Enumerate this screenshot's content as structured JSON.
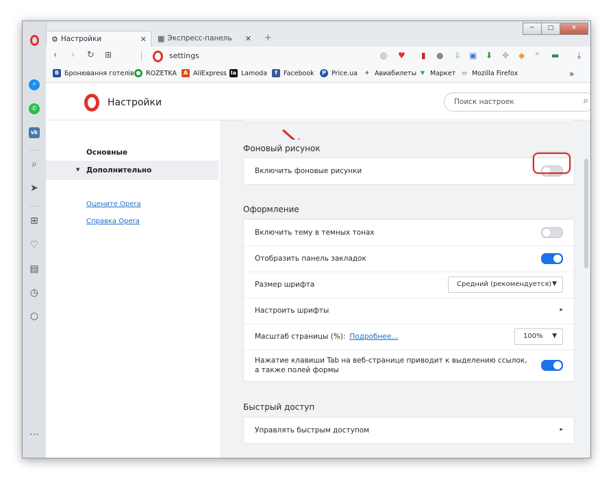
{
  "window": {
    "btn_min": "─",
    "btn_max": "□",
    "btn_close": "✕"
  },
  "tabs": [
    {
      "label": "Настройки",
      "icon": "gear-icon"
    },
    {
      "label": "Экспресс-панель",
      "icon": "grid-icon"
    }
  ],
  "tab_close": "✕",
  "new_tab": "+",
  "address": {
    "value": "settings"
  },
  "bookmarks": [
    {
      "label": "Бронювання готелів",
      "icon_char": "B",
      "color": "#1e4fa3"
    },
    {
      "label": "ROZETKA",
      "icon_char": "●",
      "color": "#1e9e3a"
    },
    {
      "label": "AliExpress",
      "icon_char": "A",
      "color": "#e64a19"
    },
    {
      "label": "Lamoda",
      "icon_char": "la",
      "color": "#111111"
    },
    {
      "label": "Facebook",
      "icon_char": "f",
      "color": "#3b5998"
    },
    {
      "label": "Price.ua",
      "icon_char": "P",
      "color": "#2455a4"
    },
    {
      "label": "Авиабилеты",
      "icon_char": "✈",
      "color": "#ffffff"
    },
    {
      "label": "Маркет",
      "icon_char": "🛒",
      "color": "#ffffff"
    },
    {
      "label": "Mozilla Firefox",
      "icon_char": "▭",
      "color": "#ffffff"
    }
  ],
  "bookmarks_more": "»",
  "settings_page": {
    "title": "Настройки",
    "search_placeholder": "Поиск настроек",
    "nav": {
      "basic": "Основные",
      "advanced": "Дополнительно",
      "rate": "Оцените Opera",
      "help": "Справка Opera"
    },
    "sections": {
      "background": {
        "title": "Фоновый рисунок",
        "rows": [
          {
            "label": "Включить фоновые рисунки",
            "toggle_on": false
          }
        ]
      },
      "appearance": {
        "title": "Оформление",
        "dark_theme": "Включить тему в темных тонах",
        "bookmarks_bar": "Отобразить панель закладок",
        "font_size": "Размер шрифта",
        "font_size_value": "Средний (рекомендуется)",
        "customize_fonts": "Настроить шрифты",
        "page_zoom": "Масштаб страницы (%):",
        "page_zoom_link": "Подробнее...",
        "page_zoom_value": "100%",
        "tab_highlight": "Нажатие клавиши Tab на веб-странице приводит к выделению ссылок, а также полей формы"
      },
      "quick_access": {
        "title": "Быстрый доступ",
        "manage": "Управлять быстрым доступом"
      }
    }
  },
  "colors": {
    "accent": "#1a73e8",
    "opera_red": "#e0322b",
    "highlight_red": "#d42b2b"
  }
}
